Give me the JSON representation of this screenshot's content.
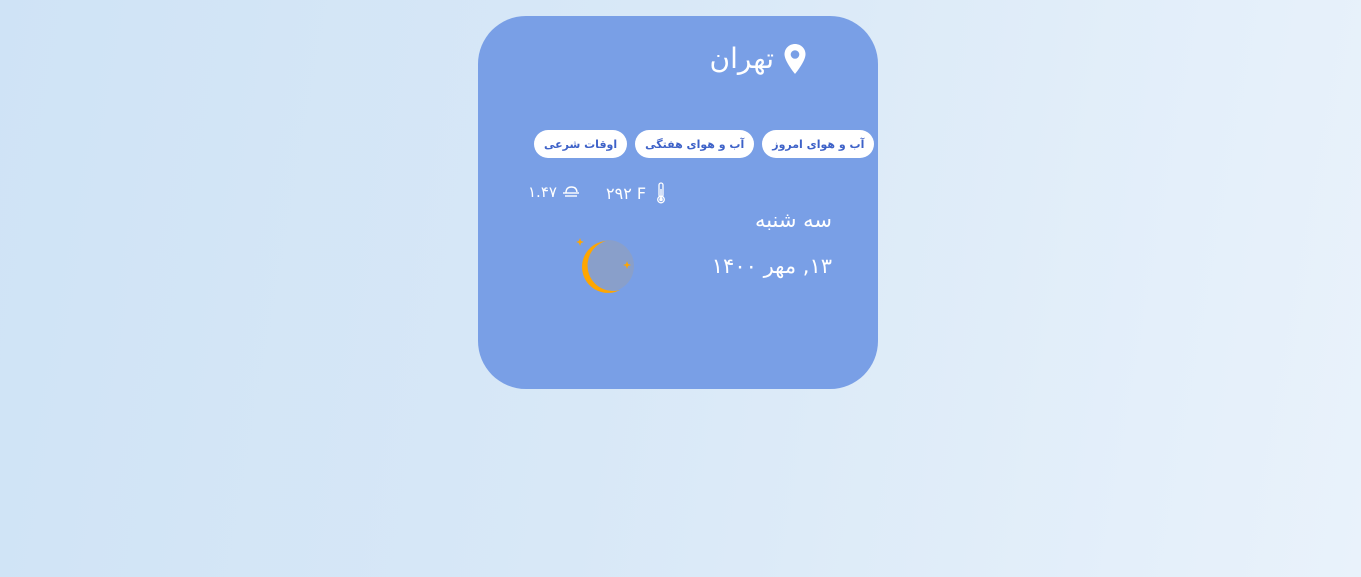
{
  "location": {
    "city": "تهران",
    "icon": "location-pin-icon"
  },
  "tabs": [
    {
      "label": "آب و هوای امروز"
    },
    {
      "label": "آب و هوای هفتگی"
    },
    {
      "label": "اوقات شرعی"
    }
  ],
  "weather": {
    "temperature": "۲۹۲ F",
    "temperature_icon": "thermometer-icon",
    "wind": "۱.۴۷",
    "wind_icon": "wind-icon",
    "condition_icon": "moon-stars-icon",
    "day": "سه شنبه",
    "date": "۱۳, مهر ۱۴۰۰"
  },
  "colors": {
    "card_bg": "#799fe6",
    "tab_text": "#3e62c8",
    "moon": "#ffa600"
  }
}
